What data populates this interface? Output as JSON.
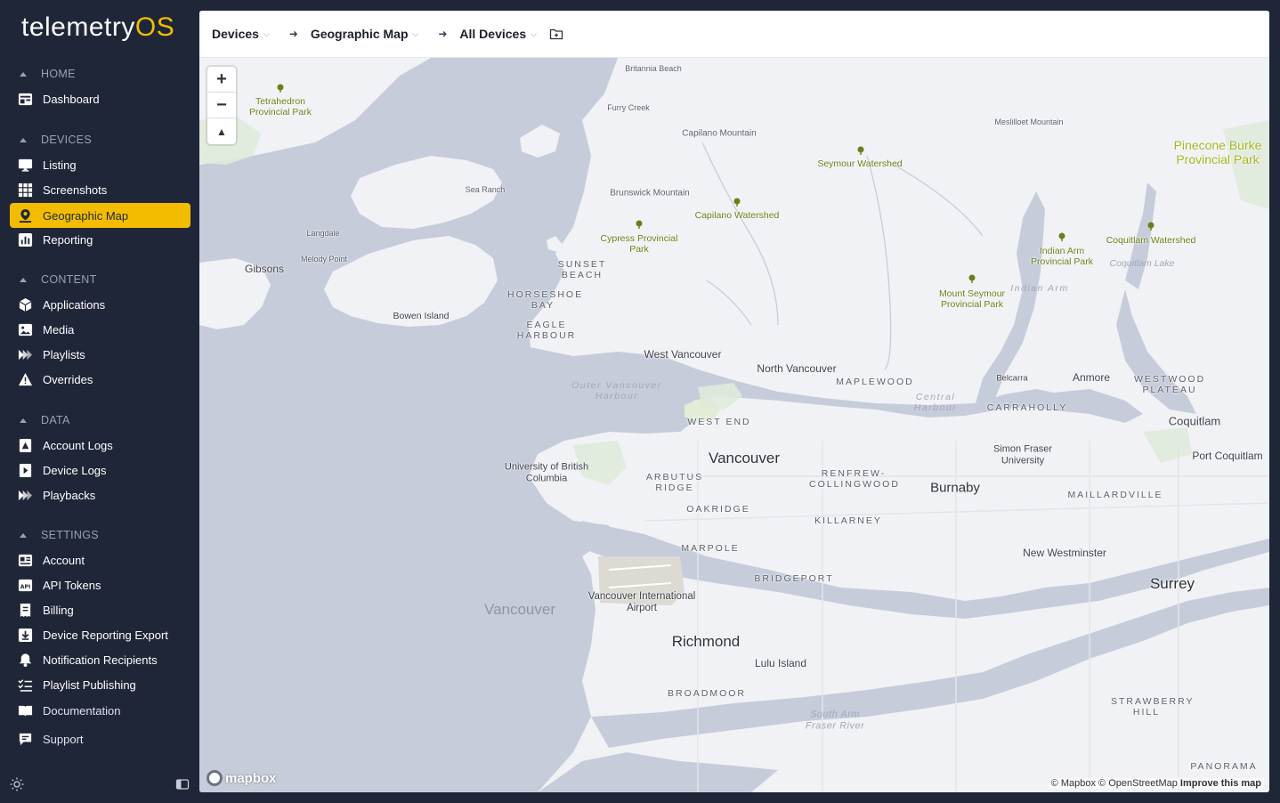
{
  "app": {
    "logo_main": "telemetry",
    "logo_accent": "OS"
  },
  "sidebar": {
    "sections": [
      {
        "title": "HOME",
        "items": [
          {
            "label": "Dashboard",
            "icon": "dashboard-icon"
          }
        ]
      },
      {
        "title": "DEVICES",
        "items": [
          {
            "label": "Listing",
            "icon": "monitor-icon"
          },
          {
            "label": "Screenshots",
            "icon": "grid-icon"
          },
          {
            "label": "Geographic Map",
            "icon": "map-pin-icon",
            "active": true
          },
          {
            "label": "Reporting",
            "icon": "bar-chart-icon"
          }
        ]
      },
      {
        "title": "CONTENT",
        "items": [
          {
            "label": "Applications",
            "icon": "cube-icon"
          },
          {
            "label": "Media",
            "icon": "image-icon"
          },
          {
            "label": "Playlists",
            "icon": "playlist-icon"
          },
          {
            "label": "Overrides",
            "icon": "warning-icon"
          }
        ]
      },
      {
        "title": "DATA",
        "items": [
          {
            "label": "Account Logs",
            "icon": "account-log-icon"
          },
          {
            "label": "Device Logs",
            "icon": "device-log-icon"
          },
          {
            "label": "Playbacks",
            "icon": "playback-icon"
          }
        ]
      },
      {
        "title": "SETTINGS",
        "items": [
          {
            "label": "Account",
            "icon": "id-card-icon"
          },
          {
            "label": "API Tokens",
            "icon": "api-icon"
          },
          {
            "label": "Billing",
            "icon": "receipt-icon"
          },
          {
            "label": "Device Reporting Export",
            "icon": "download-icon"
          },
          {
            "label": "Notification Recipients",
            "icon": "bell-icon"
          },
          {
            "label": "Playlist Publishing",
            "icon": "list-check-icon"
          }
        ]
      }
    ],
    "footer_items": [
      {
        "label": "Documentation",
        "icon": "book-icon"
      },
      {
        "label": "Support",
        "icon": "chat-icon"
      }
    ]
  },
  "breadcrumb": {
    "items": [
      {
        "label": "Devices"
      },
      {
        "label": "Geographic Map"
      },
      {
        "label": "All Devices"
      }
    ]
  },
  "map": {
    "zoom_in": "+",
    "zoom_out": "−",
    "compass": "▲",
    "logo": "mapbox",
    "attribution": {
      "mapbox": "© Mapbox",
      "osm": "© OpenStreetMap",
      "improve": "Improve this map"
    },
    "labels": {
      "cities": [
        "Vancouver",
        "Burnaby",
        "Richmond",
        "Surrey"
      ],
      "towns": [
        "West Vancouver",
        "North Vancouver",
        "New Westminster",
        "Coquitlam",
        "Port Coquitlam",
        "Anmore",
        "Gibsons",
        "Bowen Island",
        "Lulu Island",
        "Belcarra"
      ],
      "small": [
        "Britannia Beach",
        "Furry Creek",
        "Sea Ranch",
        "Langdale",
        "Melody Point",
        "Capilano Mountain",
        "Brunswick Mountain",
        "Meslilloet Mountain"
      ],
      "hoods": [
        "SUNSET BEACH",
        "HORSESHOE BAY",
        "EAGLE HARBOUR",
        "WEST END",
        "ARBUTUS RIDGE",
        "OAKRIDGE",
        "MARPOLE",
        "RENFREW-COLLINGWOOD",
        "KILLARNEY",
        "BRIDGEPORT",
        "BROADMOOR",
        "MAPLEWOOD",
        "CARRAHOLLY",
        "WESTWOOD PLATEAU",
        "MAILLARDVILLE",
        "STRAWBERRY HILL",
        "PANORAMA"
      ],
      "parks": [
        "Tetrahedron Provincial Park",
        "Seymour Watershed",
        "Capilano Watershed",
        "Cypress Provincial Park",
        "Indian Arm Provincial Park",
        "Coquitlam Watershed",
        "Mount Seymour Provincial Park"
      ],
      "big_park": "Pinecone Burke Provincial Park",
      "institutions": [
        "University of British Columbia",
        "Simon Fraser University",
        "Vancouver International Airport"
      ],
      "water": [
        "Outer Vancouver Harbour",
        "Central Harbour",
        "Indian Arm",
        "Coquitlam Lake",
        "South Arm Fraser River"
      ],
      "water_big": "Vancouver"
    }
  }
}
